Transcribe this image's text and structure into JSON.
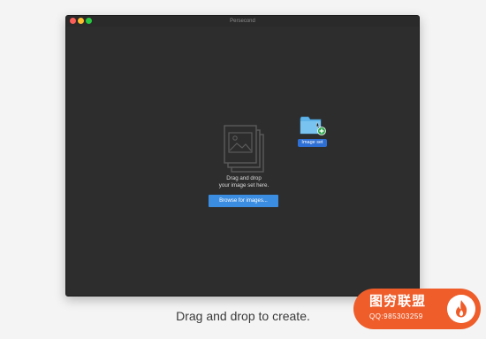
{
  "window": {
    "title": "Persecond"
  },
  "dropzone": {
    "line1": "Drag and drop",
    "line2": "your image set here.",
    "browse_label": "Browse for images...",
    "icon": "image-stack-icon"
  },
  "dragged_item": {
    "label": "Image set",
    "icon": "folder-add-icon"
  },
  "caption": "Drag and drop to create.",
  "watermark": {
    "title": "图穷联盟",
    "subtitle": "QQ:985303259"
  },
  "colors": {
    "window_bg": "#2d2d2e",
    "accent": "#3b8de1",
    "selection": "#2d6fd4",
    "close": "#fc5f57",
    "minimize": "#fdbd2e",
    "maximize": "#28c940"
  }
}
